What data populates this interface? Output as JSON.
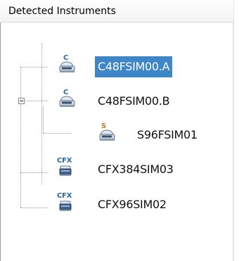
{
  "panel": {
    "header": "Detected Instruments"
  },
  "tree": {
    "items": [
      {
        "label": "C48FSIM00.A",
        "tag": "C",
        "tag_color": "#2a6aa8",
        "selected": true
      },
      {
        "label": "C48FSIM00.B",
        "tag": "C",
        "tag_color": "#2a6aa8",
        "expanded": true
      },
      {
        "label": "S96FSIM01",
        "tag": "S",
        "tag_color": "#c07a18"
      },
      {
        "label": "CFX384SIM03",
        "tag": "CFX",
        "tag_color": "#2a6aa8"
      },
      {
        "label": "CFX96SIM02",
        "tag": "CFX",
        "tag_color": "#2a6aa8"
      }
    ]
  },
  "colors": {
    "selection": "#3e86c8",
    "connector": "#9a9a9a"
  }
}
